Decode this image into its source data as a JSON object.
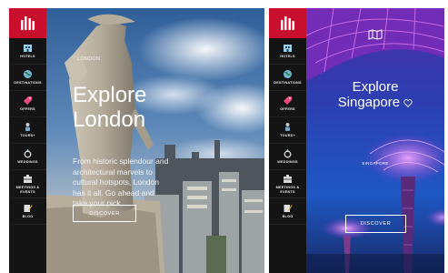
{
  "sidebar": {
    "items": [
      {
        "label": "Hotels",
        "icon": "hotel-icon"
      },
      {
        "label": "Destinations",
        "icon": "globe-icon"
      },
      {
        "label": "Offers",
        "icon": "tag-icon"
      },
      {
        "label": "Tours+",
        "icon": "tour-icon"
      },
      {
        "label": "Weddings",
        "icon": "ring-icon"
      },
      {
        "label": "Meetings & Events",
        "icon": "meeting-icon"
      },
      {
        "label": "Blog",
        "icon": "blog-icon"
      }
    ]
  },
  "london": {
    "top_label": "LONDON",
    "headline_line1": "Explore",
    "headline_line2": "London",
    "subcopy": "From historic splendour and architectural marvels to cultural hotspots, London has it all. Go ahead and take your pick.",
    "cta": "DISCOVER"
  },
  "singapore": {
    "headline_line1": "Explore",
    "headline_line2": "Singapore",
    "caption": "SINGAPORE",
    "cta": "DISCOVER"
  },
  "colors": {
    "brand_red": "#c8102e",
    "sidebar_bg": "#141414"
  }
}
